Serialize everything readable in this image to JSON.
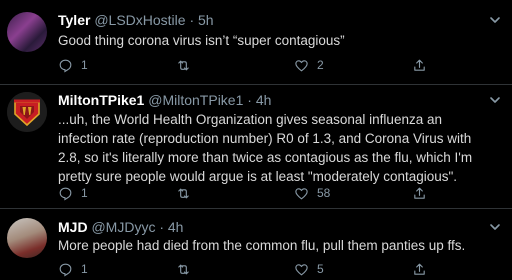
{
  "colors": {
    "background": "#000000",
    "text": "#d9d9d9",
    "muted": "#8899a6",
    "divider": "#2f3336",
    "logo_red": "#c81e23",
    "logo_gold": "#e0a528"
  },
  "tweets": [
    {
      "name": "Tyler",
      "handle": "@LSDxHostile",
      "time": "· 5h",
      "text": "Good thing corona virus isn’t “super contagious”",
      "reply_count": "1",
      "retweet_count": "",
      "like_count": "2",
      "icons": [
        "reply-icon",
        "retweet-icon",
        "like-icon",
        "share-icon",
        "chevron-down-icon"
      ]
    },
    {
      "name": "MiltonTPike1",
      "handle": "@MiltonTPike1",
      "time": "· 4h",
      "text": "...uh, the World Health Organization gives seasonal influenza an infection rate (reproduction number) R0 of 1.3, and Corona Virus with 2.8, so it's literally more than twice as contagious as the flu, which I'm pretty sure people would argue is at least \"moderately contagious\".",
      "reply_count": "1",
      "retweet_count": "",
      "like_count": "58",
      "avatar_logo_text": "MILTONTPIKE1",
      "icons": [
        "reply-icon",
        "retweet-icon",
        "like-icon",
        "share-icon",
        "chevron-down-icon"
      ]
    },
    {
      "name": "MJD",
      "handle": "@MJDyyc",
      "time": "· 4h",
      "text": "More people had died from the common flu, pull them panties up ffs.",
      "reply_count": "1",
      "retweet_count": "",
      "like_count": "5",
      "icons": [
        "reply-icon",
        "retweet-icon",
        "like-icon",
        "share-icon",
        "chevron-down-icon"
      ]
    }
  ]
}
